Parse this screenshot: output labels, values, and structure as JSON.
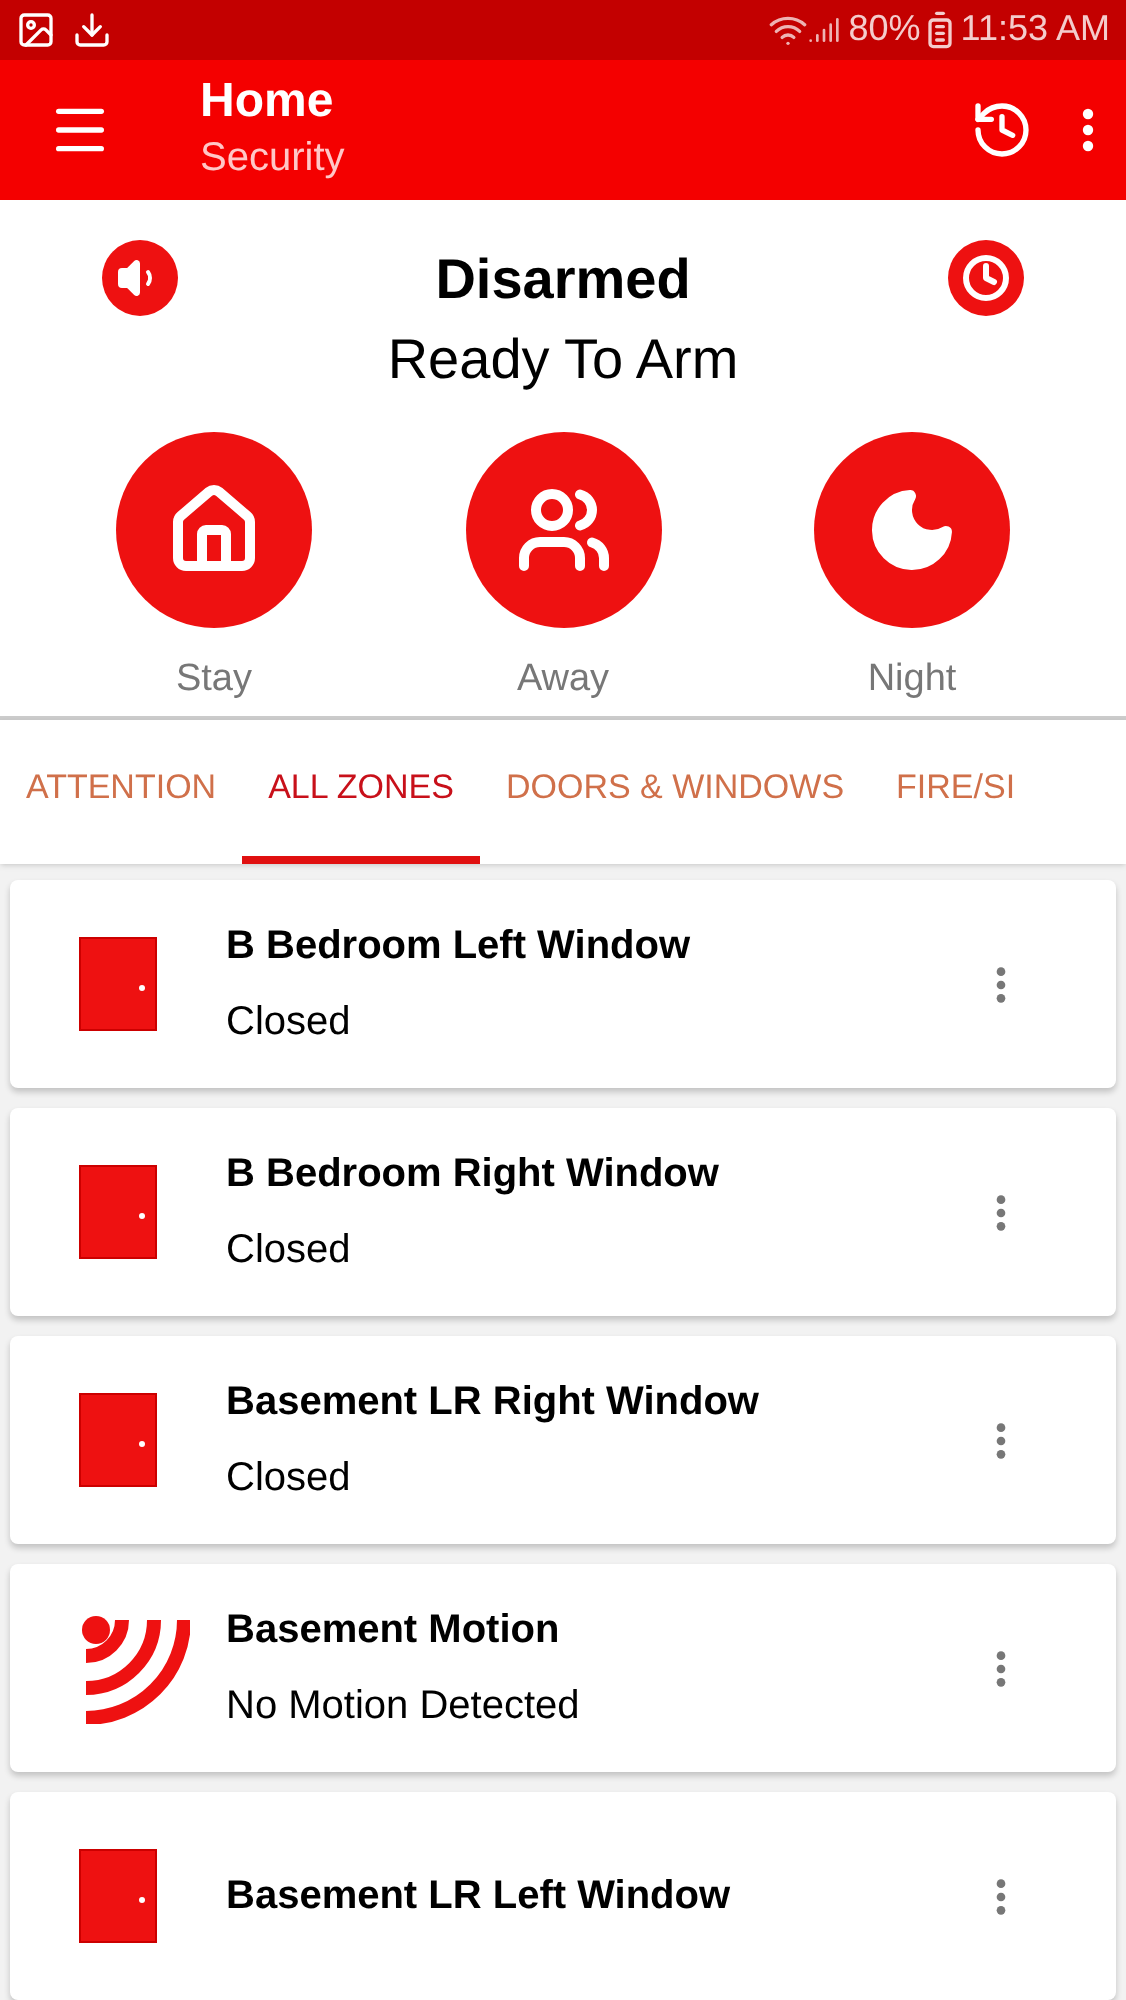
{
  "status_bar": {
    "battery": "80%",
    "time": "11:53 AM"
  },
  "app_bar": {
    "title": "Home",
    "subtitle": "Security"
  },
  "panel": {
    "status": "Disarmed",
    "message": "Ready To Arm"
  },
  "modes": [
    {
      "kind": "stay",
      "label": "Stay"
    },
    {
      "kind": "away",
      "label": "Away"
    },
    {
      "kind": "night",
      "label": "Night"
    }
  ],
  "tabs": [
    {
      "label": "ATTENTION",
      "selected": false
    },
    {
      "label": "ALL ZONES",
      "selected": true
    },
    {
      "label": "DOORS & WINDOWS",
      "selected": false
    },
    {
      "label": "FIRE/SI",
      "selected": false
    }
  ],
  "zones": [
    {
      "kind": "door",
      "name": "B Bedroom Left Window",
      "state": "Closed"
    },
    {
      "kind": "door",
      "name": "B Bedroom Right Window",
      "state": "Closed"
    },
    {
      "kind": "door",
      "name": "Basement LR Right Window",
      "state": "Closed"
    },
    {
      "kind": "motion",
      "name": "Basement Motion",
      "state": "No Motion Detected"
    },
    {
      "kind": "door",
      "name": "Basement LR Left Window"
    }
  ]
}
